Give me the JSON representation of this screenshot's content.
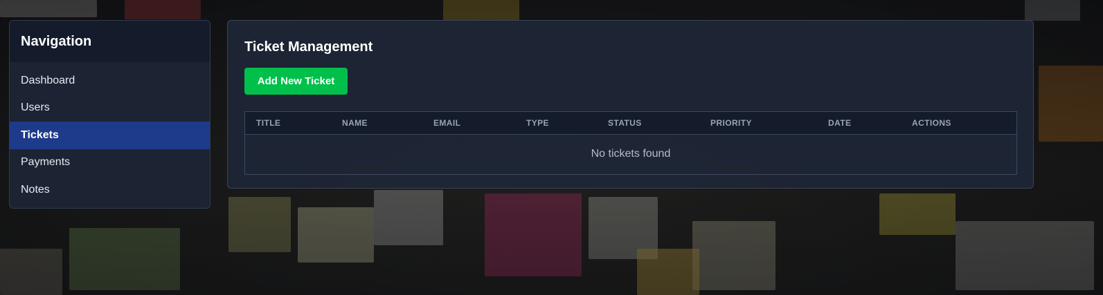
{
  "sidebar": {
    "title": "Navigation",
    "items": [
      {
        "label": "Dashboard",
        "active": false
      },
      {
        "label": "Users",
        "active": false
      },
      {
        "label": "Tickets",
        "active": true
      },
      {
        "label": "Payments",
        "active": false
      },
      {
        "label": "Notes",
        "active": false
      }
    ]
  },
  "main": {
    "title": "Ticket Management",
    "add_button_label": "Add New Ticket",
    "table": {
      "columns": [
        "TITLE",
        "NAME",
        "EMAIL",
        "TYPE",
        "STATUS",
        "PRIORITY",
        "DATE",
        "ACTIONS"
      ],
      "rows": [],
      "empty_message": "No tickets found"
    }
  },
  "colors": {
    "accent_active_nav": "#1e3a8a",
    "add_button": "#00c04b",
    "panel_bg": "#1e2636",
    "header_bg": "#141b2b"
  }
}
